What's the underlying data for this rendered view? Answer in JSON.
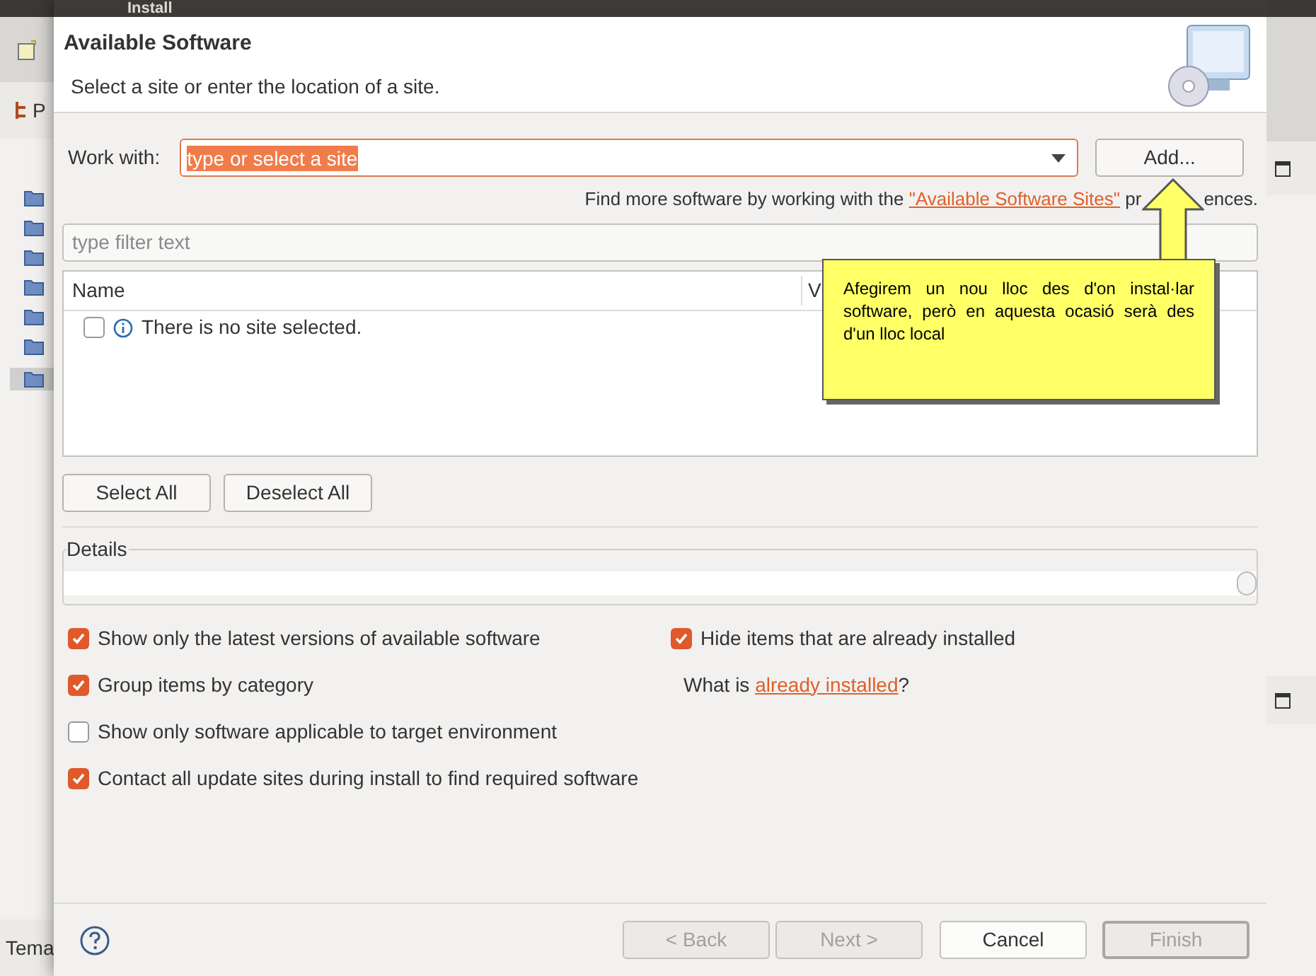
{
  "window": {
    "title": "Install"
  },
  "background": {
    "panel_title": "P",
    "status_text": "Tema"
  },
  "header": {
    "title": "Available Software",
    "subtitle": "Select a site or enter the location of a site."
  },
  "work_with": {
    "label": "Work with:",
    "value": "type or select a site",
    "add_button": "Add..."
  },
  "more_software": {
    "prefix": "Find more software by working with the ",
    "link": "\"Available Software Sites\"",
    "suffix_before": " pr",
    "suffix_after": "ences."
  },
  "filter": {
    "placeholder": "type filter text"
  },
  "table": {
    "columns": [
      "Name",
      "V"
    ],
    "rows": [
      {
        "checked": false,
        "text": "There is no site selected."
      }
    ]
  },
  "selection_buttons": [
    "Select All",
    "Deselect All"
  ],
  "details": {
    "label": "Details"
  },
  "options": [
    {
      "label": "Show only the latest versions of available software",
      "checked": true
    },
    {
      "label": "Group items by category",
      "checked": true
    },
    {
      "label": "Show only software applicable to target environment",
      "checked": false
    },
    {
      "label": "Contact all update sites during install to find required software",
      "checked": true
    }
  ],
  "hide_installed": {
    "label": "Hide items that are already installed",
    "checked": true
  },
  "what_is": {
    "prefix": "What is ",
    "link": "already installed",
    "suffix": "?"
  },
  "callout": {
    "text": "Afegirem un nou lloc des d'on instal·lar software, però en aquesta ocasió serà des d'un lloc local"
  },
  "footer_buttons": [
    {
      "label": "< Back",
      "disabled": true,
      "default": false
    },
    {
      "label": "Next >",
      "disabled": true,
      "default": false
    },
    {
      "label": "Cancel",
      "disabled": false,
      "default": false
    },
    {
      "label": "Finish",
      "disabled": true,
      "default": true
    }
  ]
}
